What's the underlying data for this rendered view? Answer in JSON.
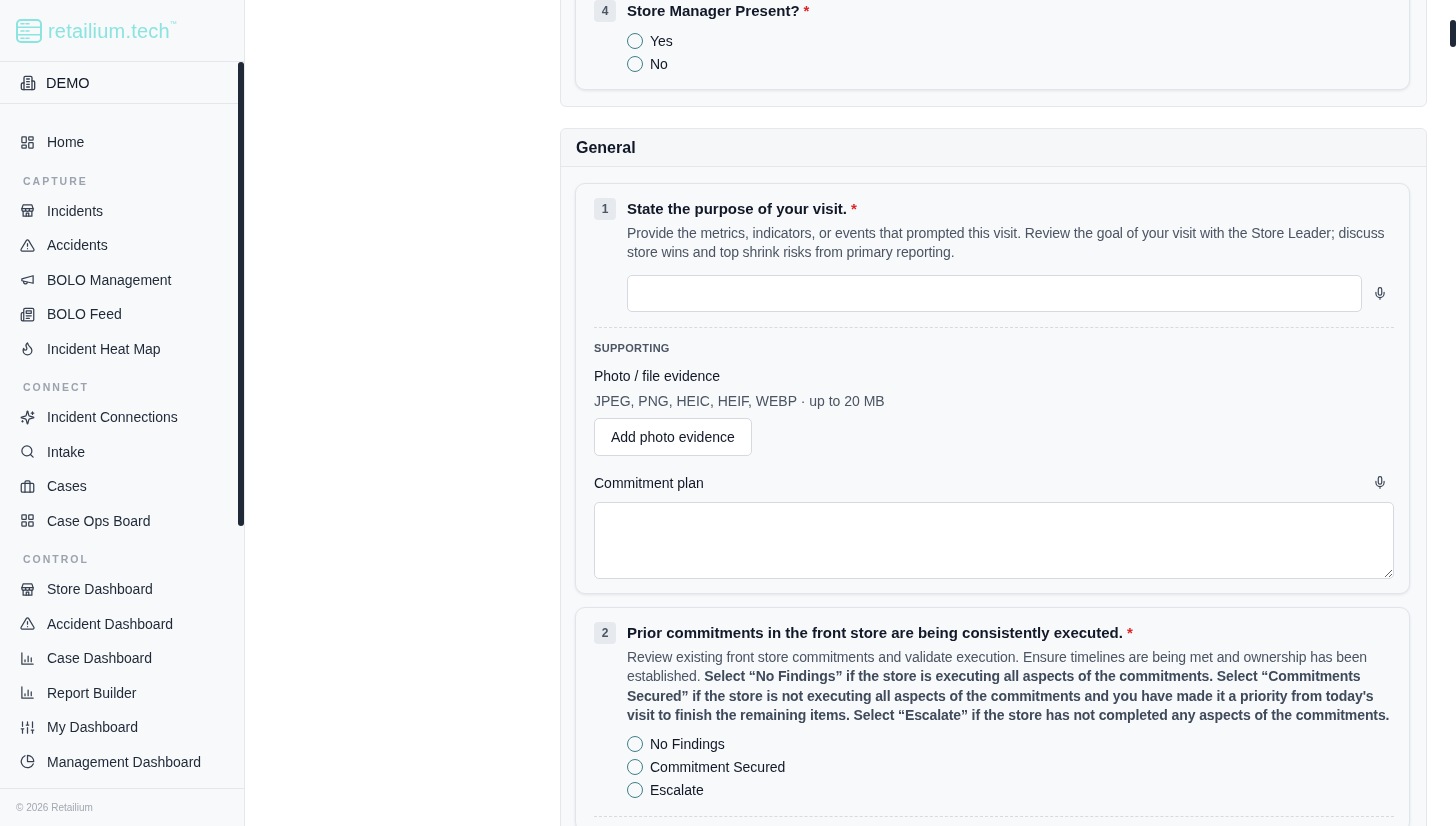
{
  "sidebar": {
    "brand": "retailium.tech$^{™}$",
    "workspace": "DEMO",
    "nav": [
      {
        "items": [
          {
            "label": "Home",
            "selected": false
          }
        ]
      },
      {
        "heading": "CAPTURE",
        "items": [
          {
            "label": "Incidents",
            "selected": false
          },
          {
            "label": "Accidents",
            "selected": false
          },
          {
            "label": "BOLO Management",
            "selected": false
          },
          {
            "label": "BOLO Feed",
            "selected": false
          },
          {
            "label": "Incident Heat Map",
            "selected": false
          }
        ]
      },
      {
        "heading": "CONNECT",
        "items": [
          {
            "label": "Incident Connections",
            "selected": false
          },
          {
            "label": "Intake",
            "selected": false
          },
          {
            "label": "Cases",
            "selected": false
          },
          {
            "label": "Case Ops Board",
            "selected": false
          }
        ]
      },
      {
        "heading": "CONTROL",
        "items": [
          {
            "label": "Store Dashboard",
            "selected": false
          },
          {
            "label": "Accident Dashboard",
            "selected": false
          },
          {
            "label": "Case Dashboard",
            "selected": false
          },
          {
            "label": "Report Builder",
            "selected": false
          },
          {
            "label": "My Dashboard",
            "selected": false
          },
          {
            "label": "Management Dashboard",
            "selected": false
          }
        ]
      }
    ],
    "footer": "© 2026 Retailium"
  },
  "form": {
    "sections": [
      {
        "questions": [
          {
            "number": "4",
            "title": "Store Manager Present?",
            "required_mark": "*",
            "kind": "choice",
            "options": [
              {
                "label": "Yes",
                "selected": false
              },
              {
                "label": "No",
                "selected": false
              }
            ]
          }
        ]
      },
      {
        "title": "General",
        "questions": [
          {
            "number": "1",
            "title": "State the purpose of your visit.",
            "required_mark": "*",
            "kind": "text",
            "description": "Provide the metrics, indicators, or events that prompted this visit. Review the goal of your visit with the Store Leader; discuss store wins and top shrink risks from primary reporting.",
            "divider": true,
            "supporting": {
              "heading": "SUPPORTING",
              "evidence_label": "Photo / file evidence",
              "evidence_hint": "JPEG, PNG, HEIC, HEIF, WEBP · up to 20 MB",
              "evidence_button": "Add photo evidence",
              "plan_label": "Commitment plan"
            }
          },
          {
            "number": "2",
            "title": "Prior commitments in the front store are being consistently executed.",
            "required_mark": "*",
            "kind": "choice",
            "description": "Review existing front store commitments and validate execution. Ensure timelines are being met and ownership has been established. **Select “No Findings” if the store is executing all aspects of the commitments. Select “Commitments Secured” if the store is not executing all aspects of the commitments and you have made it a priority from today's visit to finish the remaining items. Select “Escalate” if the store has not completed any aspects of the commitments.**",
            "options": [
              {
                "label": "No Findings",
                "selected": false
              },
              {
                "label": "Commitment Secured",
                "selected": false
              },
              {
                "label": "Escalate",
                "selected": false
              }
            ],
            "divider": true
          }
        ]
      }
    ]
  }
}
